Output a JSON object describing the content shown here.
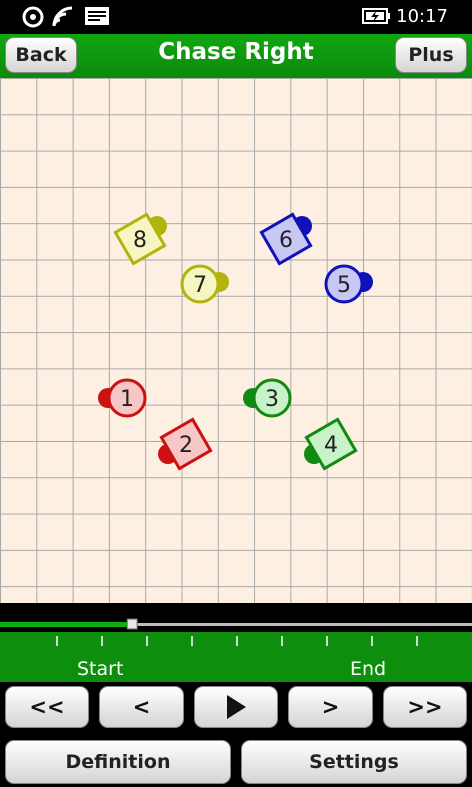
{
  "status_bar": {
    "time": "10:17",
    "icons": [
      "data-sense-icon",
      "wifi-icon",
      "message-icon",
      "battery-charging-icon"
    ]
  },
  "header": {
    "back_label": "Back",
    "title": "Chase Right",
    "plus_label": "Plus"
  },
  "canvas": {
    "dancers": [
      {
        "number": "1",
        "shape": "circle",
        "color": "#cc1111",
        "fill": "#f7c6c6",
        "facing": "left"
      },
      {
        "number": "2",
        "shape": "square",
        "color": "#cc1111",
        "fill": "#f7c6c6",
        "facing": "left"
      },
      {
        "number": "3",
        "shape": "circle",
        "color": "#118a11",
        "fill": "#c8f2c8",
        "facing": "left"
      },
      {
        "number": "4",
        "shape": "square",
        "color": "#118a11",
        "fill": "#c8f2c8",
        "facing": "left"
      },
      {
        "number": "5",
        "shape": "circle",
        "color": "#1111bb",
        "fill": "#c8c8f4",
        "facing": "right"
      },
      {
        "number": "6",
        "shape": "square",
        "color": "#1111bb",
        "fill": "#c8c8f4",
        "facing": "right"
      },
      {
        "number": "7",
        "shape": "circle",
        "color": "#b3b30e",
        "fill": "#f6f6c2",
        "facing": "right"
      },
      {
        "number": "8",
        "shape": "square",
        "color": "#b3b30e",
        "fill": "#f6f6c2",
        "facing": "right"
      }
    ]
  },
  "timeline": {
    "progress": 0.28,
    "start_label": "Start",
    "end_label": "End"
  },
  "controls": {
    "rewind_label": "<<",
    "step_back_label": "<",
    "play_icon": "play-icon",
    "step_forward_label": ">",
    "forward_label": ">>",
    "definition_label": "Definition",
    "settings_label": "Settings"
  },
  "colors": {
    "accent_green": "#0d8f0d",
    "grid_background": "#fdf0e3"
  }
}
